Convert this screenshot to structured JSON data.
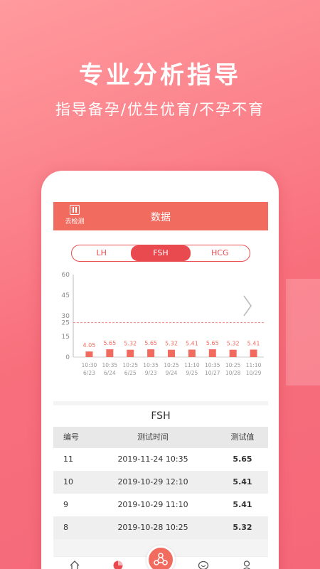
{
  "promo": {
    "headline": "专业分析指导",
    "subline": "指导备孕/优生优育/不孕不育"
  },
  "header": {
    "back_label": "去检测",
    "title": "数据"
  },
  "tabs": [
    {
      "label": "LH",
      "active": false
    },
    {
      "label": "FSH",
      "active": true
    },
    {
      "label": "HCG",
      "active": false
    }
  ],
  "chart_data": {
    "type": "bar",
    "y_ticks": [
      0,
      15,
      25,
      30,
      45,
      60
    ],
    "ylim": [
      0,
      60
    ],
    "reference_line": 25,
    "categories": [
      {
        "time": "10:30",
        "date": "6/23"
      },
      {
        "time": "10:35",
        "date": "6/24"
      },
      {
        "time": "10:25",
        "date": "6/25"
      },
      {
        "time": "10:35",
        "date": "9/23"
      },
      {
        "time": "10:25",
        "date": "9/24"
      },
      {
        "time": "11:10",
        "date": "9/25"
      },
      {
        "time": "10:35",
        "date": "10/27"
      },
      {
        "time": "10:25",
        "date": "10/28"
      },
      {
        "time": "11:10",
        "date": "10/29"
      }
    ],
    "values": [
      4.05,
      5.65,
      5.32,
      5.65,
      5.32,
      5.41,
      5.65,
      5.32,
      5.41
    ],
    "value_labels": [
      "4.05",
      "5.65",
      "5.32",
      "5.65",
      "5.32",
      "5.41",
      "5.65",
      "5.32",
      "5.41"
    ],
    "bar_color": "#f26b5f",
    "ref_color": "#f08a84"
  },
  "table": {
    "title": "FSH",
    "headers": [
      "编号",
      "测试时间",
      "测试值"
    ],
    "rows": [
      {
        "id": "11",
        "time": "2019-11-24  10:35",
        "value": "5.65"
      },
      {
        "id": "10",
        "time": "2019-10-29  12:10",
        "value": "5.41"
      },
      {
        "id": "9",
        "time": "2019-10-29  11:10",
        "value": "5.41"
      },
      {
        "id": "8",
        "time": "2019-10-28  10:25",
        "value": "5.32"
      }
    ]
  },
  "nav": [
    {
      "label": "首页",
      "icon": "home-icon"
    },
    {
      "label": "数据",
      "icon": "chart-icon"
    },
    {
      "label": "检测",
      "icon": "detect-icon"
    },
    {
      "label": "咨询",
      "icon": "chat-icon"
    },
    {
      "label": "我的",
      "icon": "profile-icon"
    }
  ],
  "colors": {
    "accent": "#e94a4f",
    "header": "#f26b5f"
  }
}
